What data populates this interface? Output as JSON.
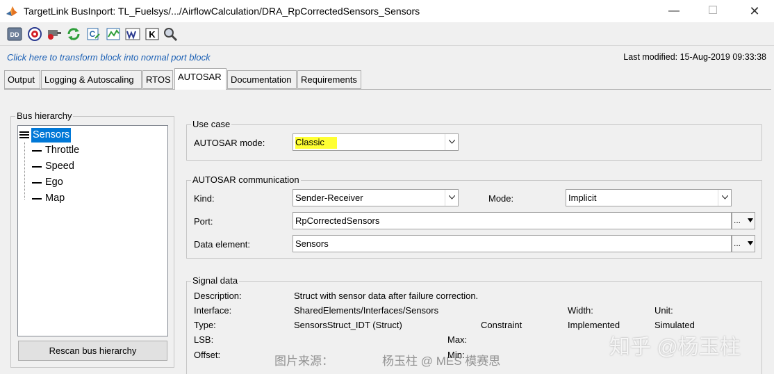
{
  "window": {
    "title": "TargetLink BusInport: TL_Fuelsys/.../AirflowCalculation/DRA_RpCorrectedSensors_Sensors",
    "minimize": "—",
    "maximize": "☐",
    "close": "✕"
  },
  "toolbar": {
    "icons": [
      "dd-icon",
      "target-icon",
      "bus-icon",
      "refresh-icon",
      "code-icon",
      "chart-icon",
      "w-icon",
      "k-icon",
      "search-icon"
    ]
  },
  "header": {
    "transform_link": "Click here to transform block into normal port block",
    "last_modified": "Last modified:  15-Aug-2019 09:33:38"
  },
  "tabs": [
    {
      "label": "Output"
    },
    {
      "label": "Logging & Autoscaling"
    },
    {
      "label": "RTOS"
    },
    {
      "label": "AUTOSAR",
      "active": true
    },
    {
      "label": "Documentation"
    },
    {
      "label": "Requirements"
    }
  ],
  "bus_hierarchy": {
    "title": "Bus hierarchy",
    "root": "Sensors",
    "children": [
      "Throttle",
      "Speed",
      "Ego",
      "Map"
    ],
    "rescan_button": "Rescan bus hierarchy"
  },
  "use_case": {
    "title": "Use case",
    "autosar_mode_label": "AUTOSAR mode:",
    "autosar_mode_value": "Classic"
  },
  "autosar_communication": {
    "title": "AUTOSAR communication",
    "kind_label": "Kind:",
    "kind_value": "Sender-Receiver",
    "mode_label": "Mode:",
    "mode_value": "Implicit",
    "port_label": "Port:",
    "port_value": "RpCorrectedSensors",
    "data_element_label": "Data element:",
    "data_element_value": "Sensors",
    "browse": "..."
  },
  "signal_data": {
    "title": "Signal data",
    "description_label": "Description:",
    "description_value": "Struct with sensor data after failure correction.",
    "interface_label": "Interface:",
    "interface_value": "SharedElements/Interfaces/Sensors",
    "width_label": "Width:",
    "unit_label": "Unit:",
    "type_label": "Type:",
    "type_value": "SensorsStruct_IDT (Struct)",
    "constraint_label": "Constraint",
    "implemented_label": "Implemented",
    "simulated_label": "Simulated",
    "lsb_label": "LSB:",
    "max_label": "Max:",
    "offset_label": "Offset:",
    "min_label": "Min:"
  },
  "watermarks": {
    "source": "图片来源：",
    "author": "杨玉柱 @ MES 模赛思",
    "zhihu": "知乎 @杨玉柱"
  },
  "colors": {
    "selection": "#0078d7",
    "highlight": "#ffff33",
    "link": "#1a5fb4"
  }
}
